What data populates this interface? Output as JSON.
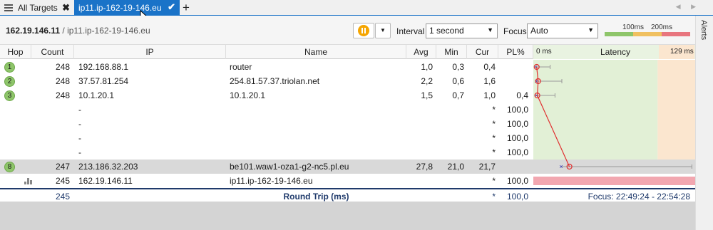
{
  "tabs": {
    "all_label": "All Targets",
    "active_label": "ip11.ip-162-19-146.eu",
    "add_label": "+",
    "close_glyph": "✖",
    "check_glyph": "✔",
    "scroll_glyphs": "◀ ▶"
  },
  "toolbar": {
    "ip": "162.19.146.11",
    "separator": " / ",
    "host": "ip11.ip-162-19-146.eu",
    "dropdown_glyph": "▼",
    "interval_label": "Interval",
    "interval_value": "1 second",
    "focus_label": "Focus",
    "focus_value": "Auto",
    "legend_100": "100ms",
    "legend_200": "200ms",
    "legend_colors": [
      "#8ec56a",
      "#f0c060",
      "#e8757e"
    ]
  },
  "alerts_label": "Alerts",
  "columns": {
    "hop": "Hop",
    "count": "Count",
    "ip": "IP",
    "name": "Name",
    "avg": "Avg",
    "min": "Min",
    "cur": "Cur",
    "pl": "PL%",
    "latency_min": "0 ms",
    "latency": "Latency",
    "latency_max": "129 ms"
  },
  "rows": [
    {
      "hop": "1",
      "count": "248",
      "ip": "192.168.88.1",
      "name": "router",
      "avg": "1,0",
      "min": "0,3",
      "cur": "0,4",
      "pl": ""
    },
    {
      "hop": "2",
      "count": "248",
      "ip": "37.57.81.254",
      "name": "254.81.57.37.triolan.net",
      "avg": "2,2",
      "min": "0,6",
      "cur": "1,6",
      "pl": ""
    },
    {
      "hop": "3",
      "count": "248",
      "ip": "10.1.20.1",
      "name": "10.1.20.1",
      "avg": "1,5",
      "min": "0,7",
      "cur": "1,0",
      "pl": "0,4"
    },
    {
      "hop": "",
      "count": "",
      "ip": "-",
      "name": "",
      "avg": "",
      "min": "",
      "cur": "*",
      "pl": "100,0"
    },
    {
      "hop": "",
      "count": "",
      "ip": "-",
      "name": "",
      "avg": "",
      "min": "",
      "cur": "*",
      "pl": "100,0"
    },
    {
      "hop": "",
      "count": "",
      "ip": "-",
      "name": "",
      "avg": "",
      "min": "",
      "cur": "*",
      "pl": "100,0"
    },
    {
      "hop": "",
      "count": "",
      "ip": "-",
      "name": "",
      "avg": "",
      "min": "",
      "cur": "*",
      "pl": "100,0"
    },
    {
      "hop": "8",
      "count": "247",
      "ip": "213.186.32.203",
      "name": "be101.waw1-oza1-g2-nc5.pl.eu",
      "avg": "27,8",
      "min": "21,0",
      "cur": "21,7",
      "pl": ""
    },
    {
      "hop": "",
      "count": "245",
      "ip": "162.19.146.11",
      "name": "ip11.ip-162-19-146.eu",
      "avg": "",
      "min": "",
      "cur": "*",
      "pl": "100,0"
    }
  ],
  "summary": {
    "count": "245",
    "label": "Round Trip (ms)",
    "cur": "*",
    "pl": "100,0",
    "focus": "Focus: 22:49:24 - 22:54:28"
  }
}
